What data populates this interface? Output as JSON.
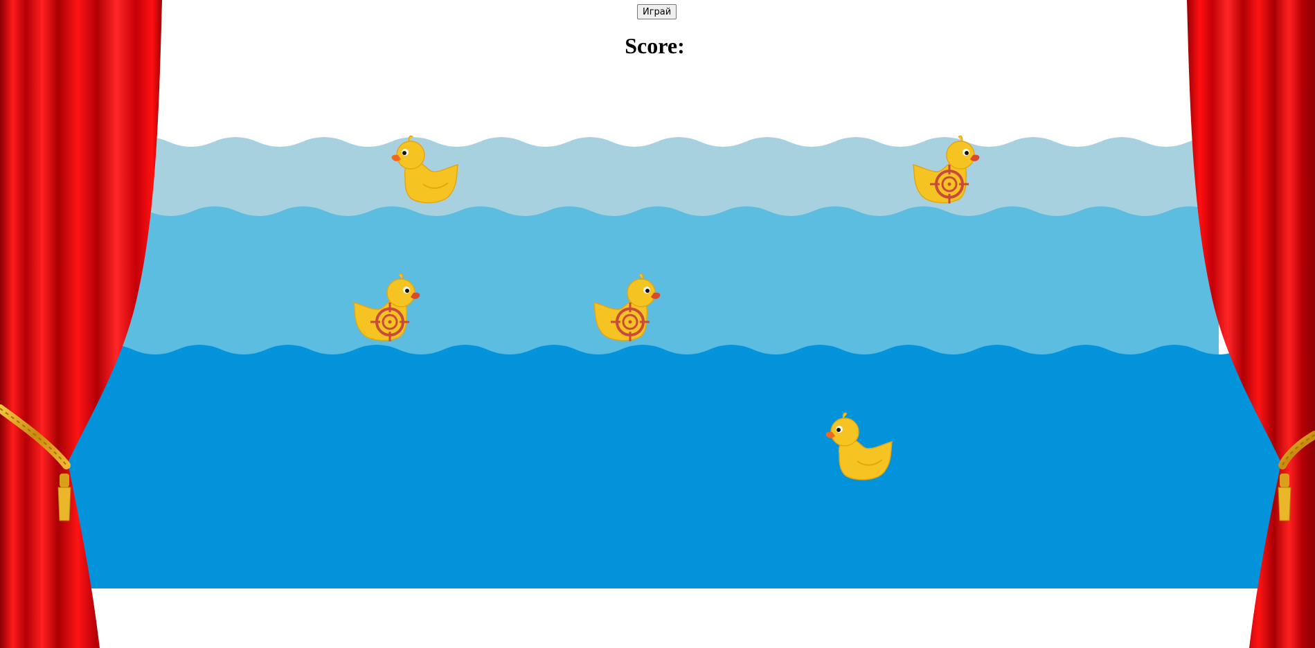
{
  "controls": {
    "play_label": "Играй"
  },
  "score": {
    "label": "Score:",
    "value": ""
  },
  "colors": {
    "water_back": "#a8d1df",
    "water_middle": "#5dbde0",
    "water_front": "#0293da",
    "curtain_red": "#e40008",
    "duck_yellow": "#f6c422",
    "target_red": "#c94a3a"
  },
  "ducks": [
    {
      "row": "back",
      "facing": "left",
      "target": false
    },
    {
      "row": "back",
      "facing": "right",
      "target": true
    },
    {
      "row": "middle",
      "facing": "right",
      "target": true
    },
    {
      "row": "middle",
      "facing": "right",
      "target": true
    },
    {
      "row": "front",
      "facing": "left",
      "target": false
    }
  ]
}
